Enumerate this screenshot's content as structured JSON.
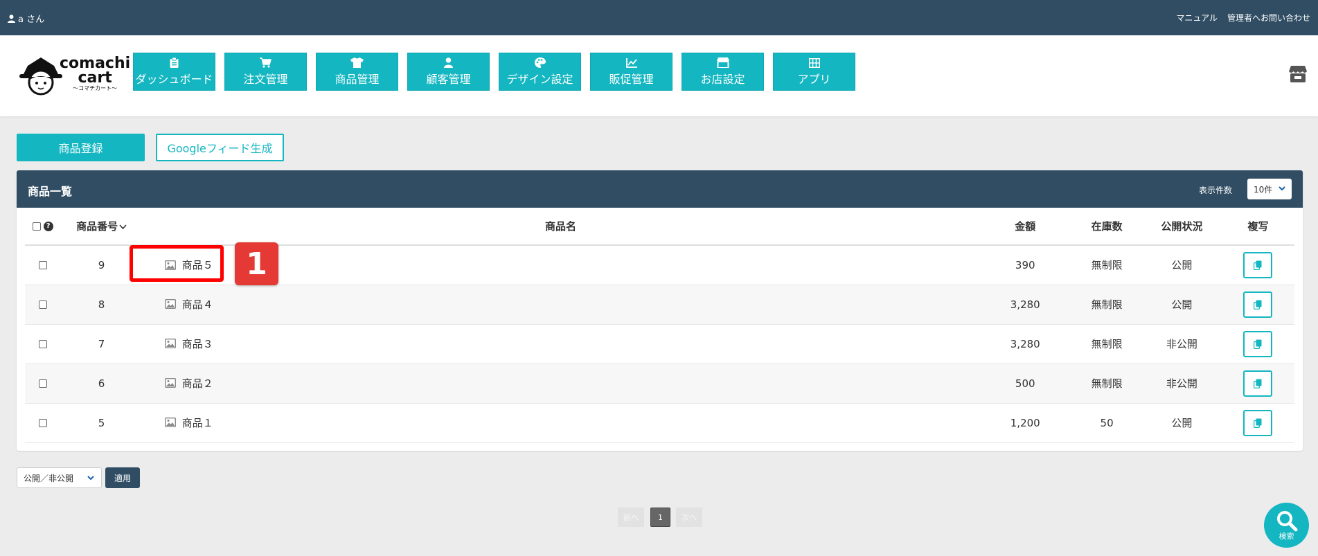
{
  "topbar": {
    "user_name": "a さん",
    "links": [
      "マニュアル",
      "管理者へお問い合わせ"
    ]
  },
  "logo": {
    "line1": "comachi",
    "line2": "cart",
    "line3": "〜コマチカート〜"
  },
  "nav": [
    {
      "label": "ダッシュボード",
      "icon": "clipboard-icon"
    },
    {
      "label": "注文管理",
      "icon": "cart-icon"
    },
    {
      "label": "商品管理",
      "icon": "tshirt-icon"
    },
    {
      "label": "顧客管理",
      "icon": "user-icon"
    },
    {
      "label": "デザイン設定",
      "icon": "palette-icon"
    },
    {
      "label": "販促管理",
      "icon": "chart-line-icon"
    },
    {
      "label": "お店設定",
      "icon": "store-icon"
    },
    {
      "label": "アプリ",
      "icon": "grid-icon"
    }
  ],
  "actions": {
    "register": "商品登録",
    "feed": "Googleフィード生成"
  },
  "panel": {
    "title": "商品一覧",
    "display_count_label": "表示件数",
    "display_count_value": "10件"
  },
  "table": {
    "headers": {
      "number": "商品番号",
      "name": "商品名",
      "price": "金額",
      "stock": "在庫数",
      "status": "公開状況",
      "copy": "複写"
    },
    "rows": [
      {
        "number": "9",
        "name": "商品５",
        "price": "390",
        "stock": "無制限",
        "status": "公開"
      },
      {
        "number": "8",
        "name": "商品４",
        "price": "3,280",
        "stock": "無制限",
        "status": "公開"
      },
      {
        "number": "7",
        "name": "商品３",
        "price": "3,280",
        "stock": "無制限",
        "status": "非公開"
      },
      {
        "number": "6",
        "name": "商品２",
        "price": "500",
        "stock": "無制限",
        "status": "非公開"
      },
      {
        "number": "5",
        "name": "商品１",
        "price": "1,200",
        "stock": "50",
        "status": "公開"
      }
    ]
  },
  "annotation": {
    "step": "1"
  },
  "bulk": {
    "select_value": "公開／非公開",
    "apply": "適用"
  },
  "pagination": {
    "prev": "前へ",
    "current": "1",
    "next": "次へ"
  },
  "search_fab": {
    "label": "検索"
  },
  "colors": {
    "accent": "#13b6c1",
    "dark": "#304d63",
    "annotation": "#e53935"
  }
}
